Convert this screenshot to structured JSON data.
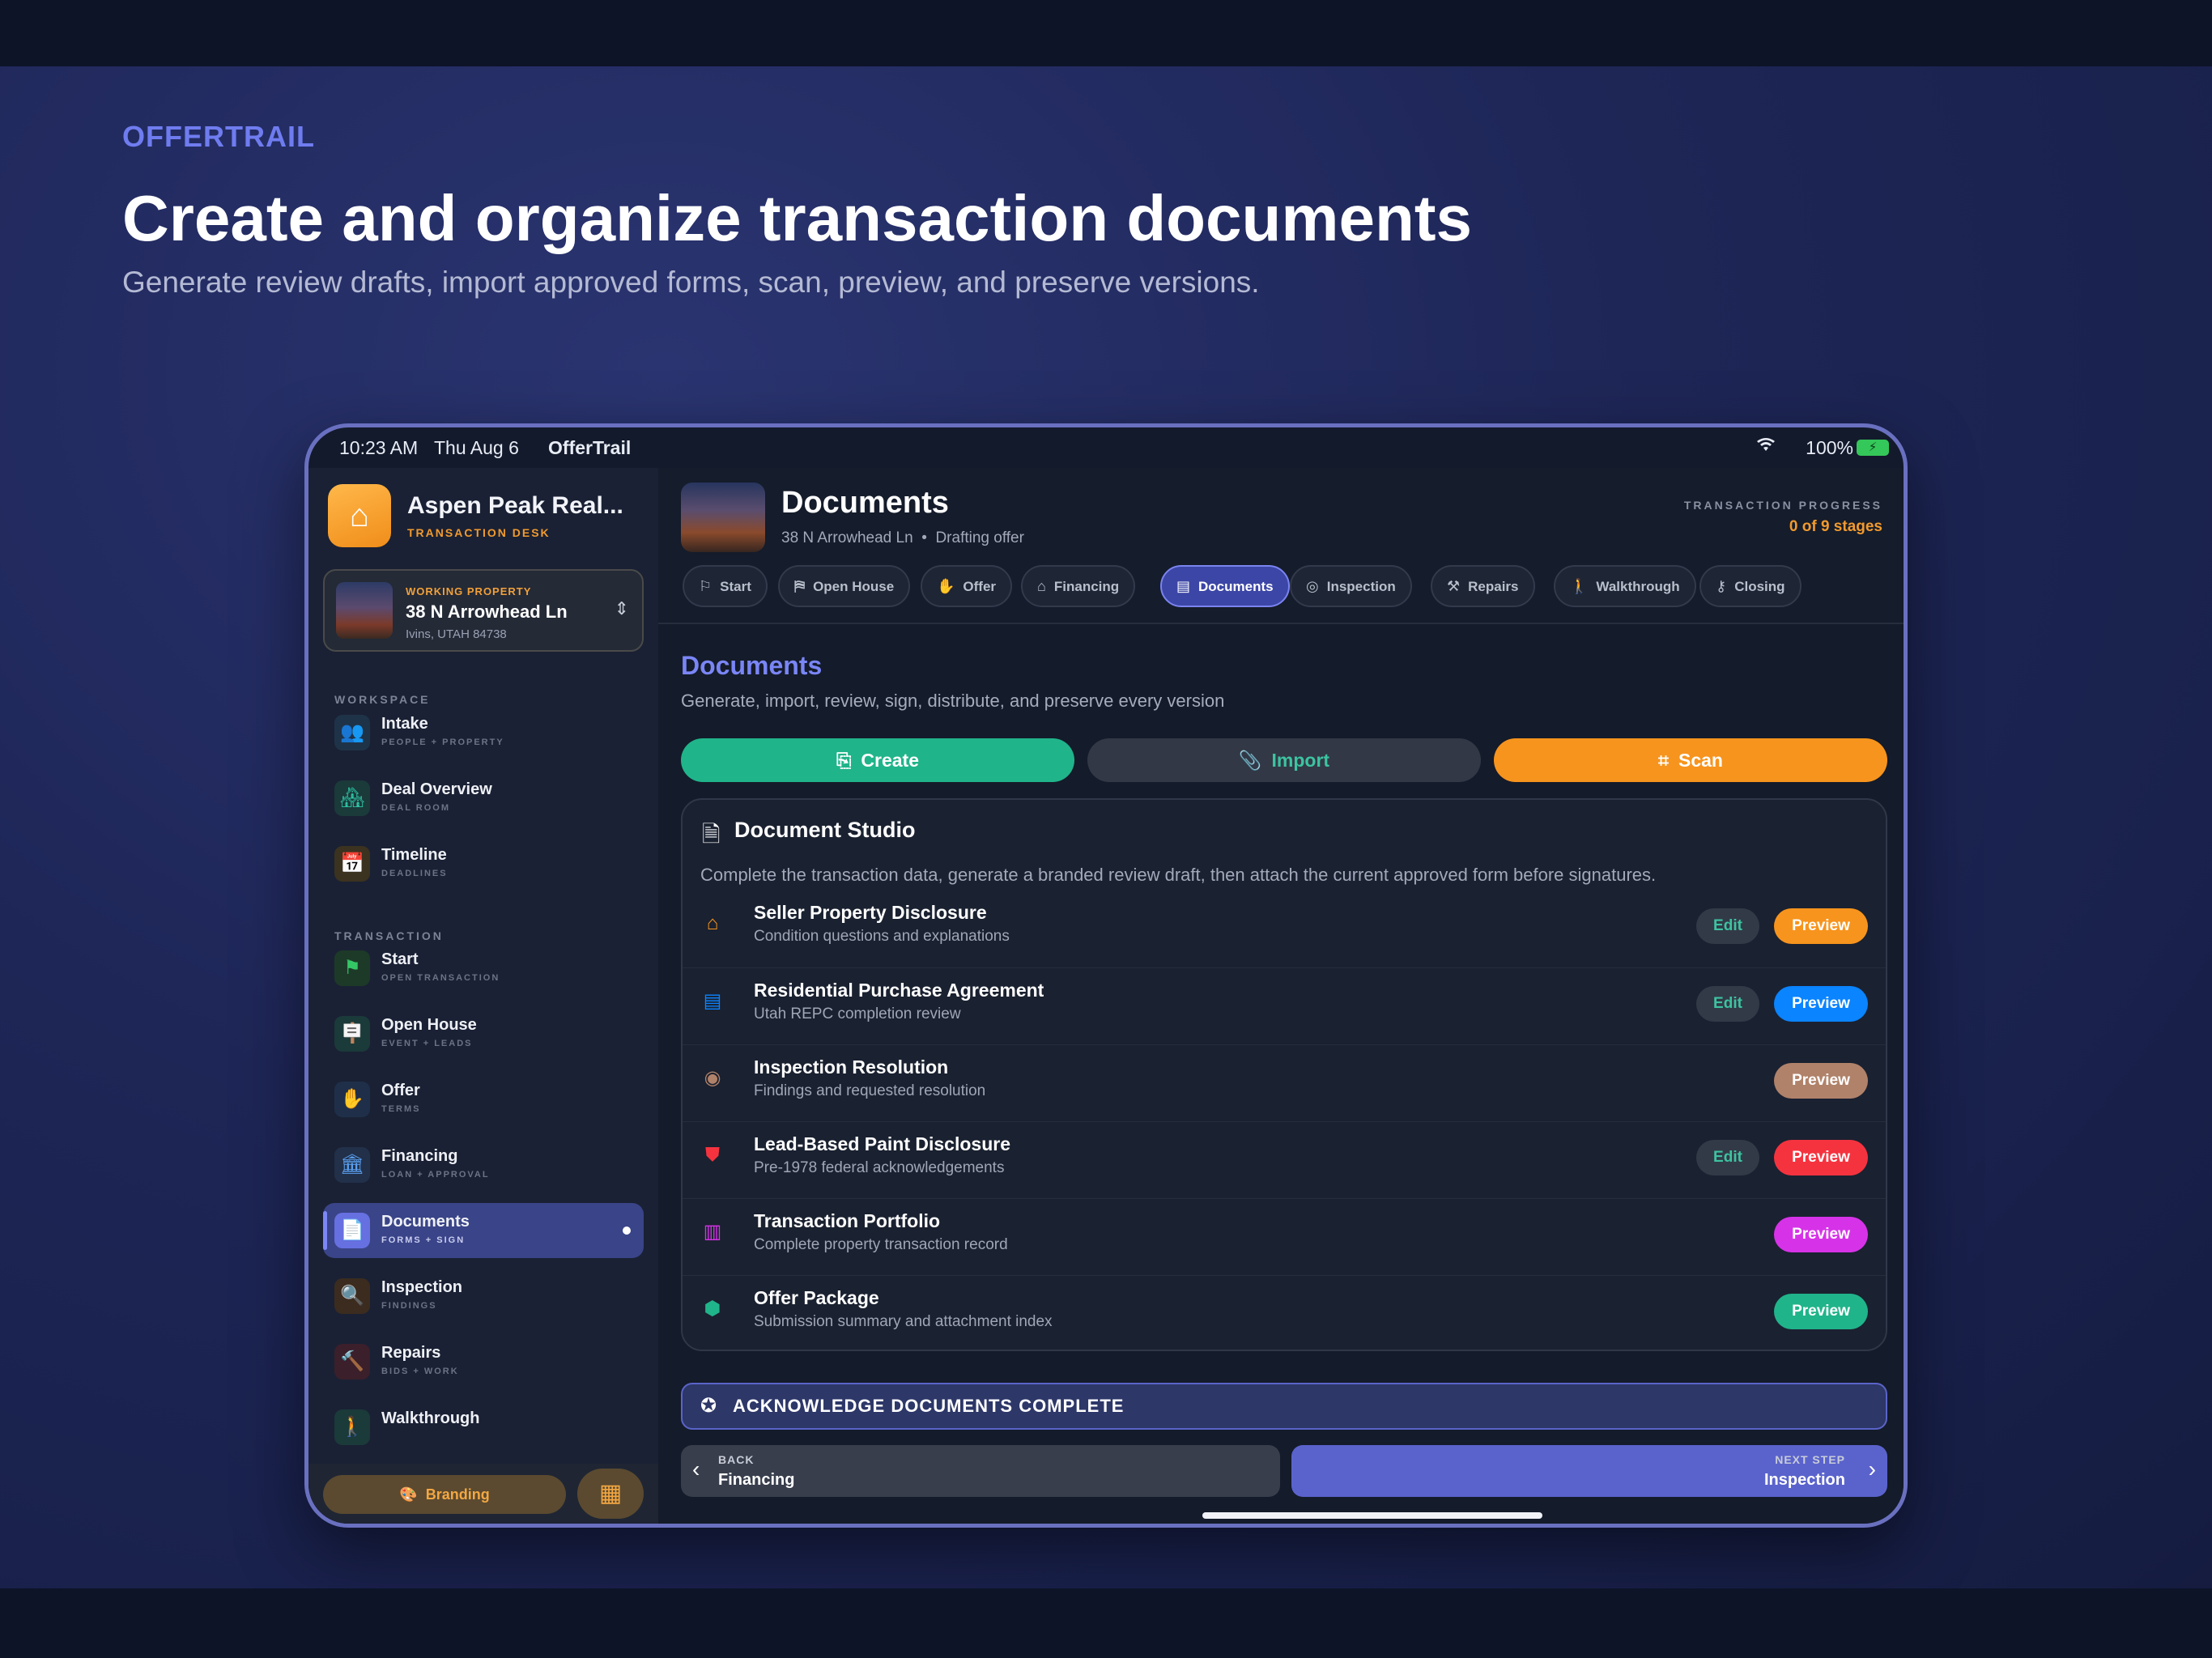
{
  "hero": {
    "brand": "OFFERTRAIL",
    "title": "Create and organize transaction documents",
    "subtitle": "Generate review drafts, import approved forms, scan, preview, and preserve versions."
  },
  "status_bar": {
    "time": "10:23 AM",
    "date": "Thu Aug 6",
    "app": "OfferTrail",
    "wifi_icon": "wifi-icon",
    "battery": "100%"
  },
  "sidebar": {
    "app_name": "Aspen Peak Real...",
    "app_sub": "TRANSACTION DESK",
    "property": {
      "label": "WORKING PROPERTY",
      "address": "38 N Arrowhead Ln",
      "city": "Ivins, UTAH 84738"
    },
    "workspace_label": "WORKSPACE",
    "workspace_items": [
      {
        "label": "Intake",
        "sub": "PEOPLE + PROPERTY",
        "icon": "people-icon"
      },
      {
        "label": "Deal Overview",
        "sub": "DEAL ROOM",
        "icon": "house-icon"
      },
      {
        "label": "Timeline",
        "sub": "DEADLINES",
        "icon": "calendar-icon"
      }
    ],
    "transaction_label": "TRANSACTION",
    "transaction_items": [
      {
        "label": "Start",
        "sub": "OPEN TRANSACTION",
        "icon": "flag-icon"
      },
      {
        "label": "Open House",
        "sub": "EVENT + LEADS",
        "icon": "signpost-icon"
      },
      {
        "label": "Offer",
        "sub": "TERMS",
        "icon": "hand-icon"
      },
      {
        "label": "Financing",
        "sub": "LOAN + APPROVAL",
        "icon": "bank-icon"
      },
      {
        "label": "Documents",
        "sub": "FORMS + SIGN",
        "icon": "document-icon"
      },
      {
        "label": "Inspection",
        "sub": "FINDINGS",
        "icon": "magnifier-icon"
      },
      {
        "label": "Repairs",
        "sub": "BIDS + WORK",
        "icon": "hammer-icon"
      },
      {
        "label": "Walkthrough",
        "sub": "",
        "icon": "walk-icon"
      }
    ],
    "branding_label": "Branding"
  },
  "header": {
    "title": "Documents",
    "address": "38 N Arrowhead Ln",
    "status": "Drafting offer",
    "progress_label": "TRANSACTION PROGRESS",
    "progress_value": "0 of 9 stages",
    "tabs": [
      {
        "label": "Start",
        "icon": "flag-icon"
      },
      {
        "label": "Open House",
        "icon": "signpost-icon"
      },
      {
        "label": "Offer",
        "icon": "hand-icon"
      },
      {
        "label": "Financing",
        "icon": "bank-icon"
      },
      {
        "label": "Documents",
        "icon": "document-icon"
      },
      {
        "label": "Inspection",
        "icon": "magnifier-icon"
      },
      {
        "label": "Repairs",
        "icon": "hammer-icon"
      },
      {
        "label": "Walkthrough",
        "icon": "walk-icon"
      },
      {
        "label": "Closing",
        "icon": "key-icon"
      }
    ]
  },
  "section": {
    "title": "Documents",
    "subtitle": "Generate, import, review, sign, distribute, and preserve every version",
    "actions": {
      "create": "Create",
      "import": "Import",
      "scan": "Scan"
    }
  },
  "studio": {
    "title": "Document Studio",
    "description": "Complete the transaction data, generate a branded review draft, then attach the current approved form before signatures.",
    "edit_label": "Edit",
    "preview_label": "Preview",
    "documents": [
      {
        "title": "Seller Property Disclosure",
        "sub": "Condition questions and explanations",
        "icon": "house-flag-icon",
        "color": "#f7941d"
      },
      {
        "title": "Residential Purchase Agreement",
        "sub": "Utah REPC completion review",
        "icon": "document-icon",
        "color": "#0a84ff"
      },
      {
        "title": "Inspection Resolution",
        "sub": "Findings and requested resolution",
        "icon": "magnifier-icon",
        "color": "#b0826a"
      },
      {
        "title": "Lead-Based Paint Disclosure",
        "sub": "Pre-1978 federal acknowledgements",
        "icon": "shield-icon",
        "color": "#f5333f"
      },
      {
        "title": "Transaction Portfolio",
        "sub": "Complete property transaction record",
        "icon": "chart-icon",
        "color": "#d633e8"
      },
      {
        "title": "Offer Package",
        "sub": "Submission summary and attachment index",
        "icon": "box-icon",
        "color": "#20b48a"
      }
    ]
  },
  "footer": {
    "acknowledge": "ACKNOWLEDGE DOCUMENTS COMPLETE",
    "back_label": "BACK",
    "back_target": "Financing",
    "next_label": "NEXT STEP",
    "next_target": "Inspection"
  }
}
